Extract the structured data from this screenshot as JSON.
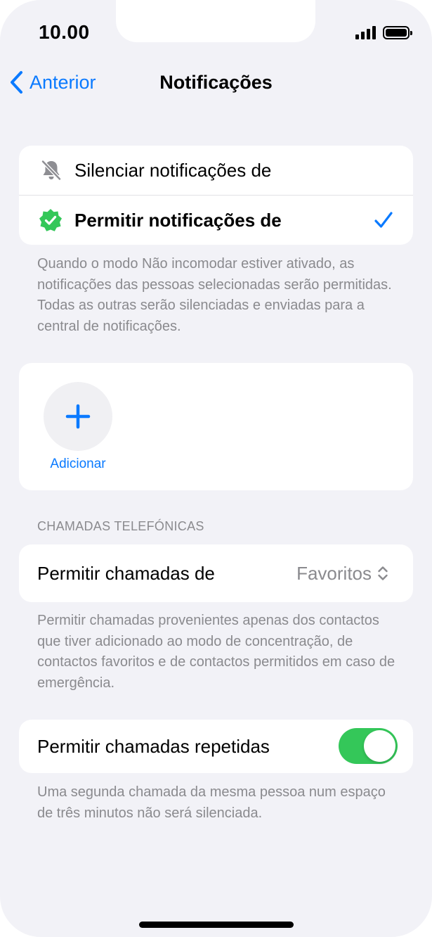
{
  "status_bar": {
    "time": "10.00"
  },
  "nav": {
    "back_label": "Anterior",
    "title": "Notificações"
  },
  "notifications": {
    "options": [
      {
        "label": "Silenciar notificações de",
        "icon": "bell-slash-icon",
        "selected": false
      },
      {
        "label": "Permitir notificações de",
        "icon": "verified-badge-icon",
        "selected": true
      }
    ],
    "footnote": "Quando o modo Não incomodar estiver ativado, as notificações das pessoas selecionadas serão permitidas. Todas as outras serão silenciadas e enviadas para a central de notificações."
  },
  "people": {
    "add_label": "Adicionar"
  },
  "calls": {
    "section_header": "CHAMADAS TELEFÓNICAS",
    "allow_label": "Permitir chamadas de",
    "allow_value": "Favoritos",
    "allow_footnote": "Permitir chamadas provenientes apenas dos contactos que tiver adicionado ao modo de concentração, de contactos favoritos e de contactos permitidos em caso de emergência.",
    "repeated_label": "Permitir chamadas repetidas",
    "repeated_enabled": true,
    "repeated_footnote": "Uma segunda chamada da mesma pessoa num espaço de três minutos não será silenciada."
  },
  "colors": {
    "accent": "#0a7aff",
    "toggle_on": "#34c759",
    "badge_green": "#34c759",
    "background": "#f2f2f7",
    "secondary_text": "#8a8a8e"
  }
}
